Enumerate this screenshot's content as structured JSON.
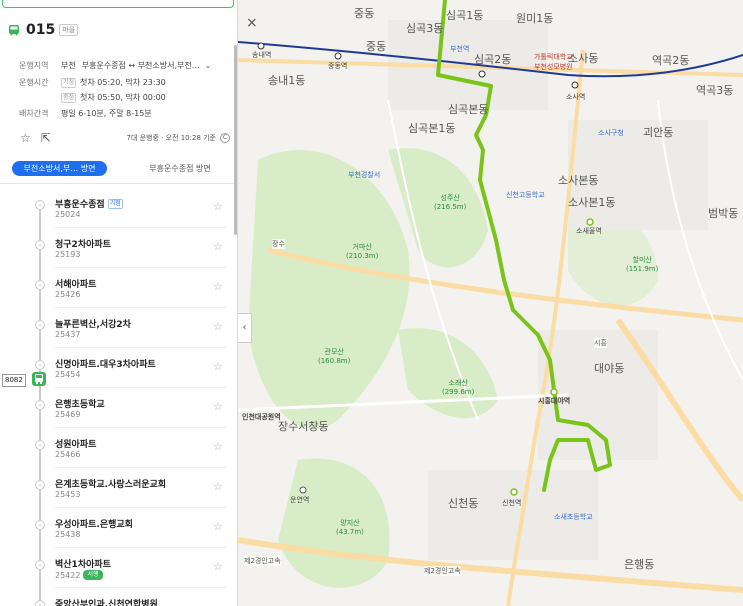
{
  "route": {
    "number": "015",
    "type": "마을"
  },
  "info": {
    "region_label": "운행지역",
    "region_city": "부천",
    "region_value": "부흥운수종점 ↔ 부천소방서,부천…",
    "time_label": "운행시간",
    "weekday_tag": "기점",
    "weekday_time": "첫차 05:20, 막차 23:30",
    "end_tag": "종점",
    "end_time": "첫차 05:50, 막차 00:00",
    "interval_label": "배차간격",
    "interval_value": "평일 6-10분, 주말 8-15분"
  },
  "actions": {
    "star_icon": "☆",
    "share_icon": "⇱",
    "status": "7대 운행중 · 오전 10:28 기준",
    "refresh_icon": "C"
  },
  "tabs": {
    "active": "부천소방서,부… 방면",
    "other": "부흥운수종점 방면"
  },
  "stops": [
    {
      "name": "부흥운수종점",
      "id": "25024",
      "tag": "기점",
      "tag_style": "blue"
    },
    {
      "name": "청구2차아파트",
      "id": "25193",
      "tag": "",
      "tag_style": ""
    },
    {
      "name": "서해아파트",
      "id": "25426",
      "tag": "",
      "tag_style": ""
    },
    {
      "name": "늘푸른벽산,서강2차",
      "id": "25437",
      "tag": "",
      "tag_style": ""
    },
    {
      "name": "신명아파트.대우3차아파트",
      "id": "25454",
      "tag": "",
      "tag_style": ""
    },
    {
      "name": "은행초등학교",
      "id": "25469",
      "tag": "",
      "tag_style": ""
    },
    {
      "name": "성원아파트",
      "id": "25466",
      "tag": "",
      "tag_style": ""
    },
    {
      "name": "은계초등학교.사랑스러운교회",
      "id": "25453",
      "tag": "",
      "tag_style": ""
    },
    {
      "name": "우성아파트.은행교회",
      "id": "25438",
      "tag": "",
      "tag_style": ""
    },
    {
      "name": "벽산1차아파트",
      "id": "25422",
      "tag": "서행",
      "tag_style": "green"
    },
    {
      "name": "중앙산부인과.신천연합병원",
      "id": "",
      "tag": "",
      "tag_style": ""
    }
  ],
  "bus": {
    "plate": "8082"
  },
  "map": {
    "controls": {
      "close": "×",
      "collapse": "‹"
    },
    "labels": {
      "jungdong": "중동",
      "simgok3": "심곡3동",
      "simgok1": "심곡1동",
      "wonmi1": "원미1동",
      "simgok2": "심곡2동",
      "songnae1": "송내1동",
      "jungdong2": "중동",
      "simgokbon1": "심곡본1동",
      "simgokbon": "심곡본동",
      "sosadong": "소사동",
      "yeokgok2": "역곡2동",
      "yeokgok3": "역곡3동",
      "goan": "괴안동",
      "sosabon": "소사본동",
      "sosabon1": "소사본1동",
      "beoman": "범박동",
      "daeya": "대야동",
      "jangsuseochang": "장수서창동",
      "sincheon": "신천동",
      "eunhaeng": "은행동",
      "songnae_station": "송내역",
      "jungdong_station": "중동역",
      "bucheon_station": "부천역",
      "sosa_station": "소사역",
      "sosaeul_station": "소새울역",
      "siheung_daeya_station": "시흥대야역",
      "sincheon_station": "신천역",
      "incheon_park_station": "인천대공원역",
      "unyeon_station": "운연역",
      "gamasan": "거마산",
      "gamasan_h": "(210.3m)",
      "seongjusan": "성주산",
      "seongjusan_h": "(216.5m)",
      "gwangeumsan": "관모산",
      "gwangeumsan_h": "(160.8m)",
      "soraesan": "소래산",
      "soraesan_h": "(299.6m)",
      "halmisan": "할미산",
      "halmisan_h": "(151.9m)",
      "yangjisan": "양지산",
      "yangjisan_h": "(43.7m)",
      "gatoreuk": "가톨릭대학교",
      "gatoreuk2": "부천성모병원",
      "road_2gyeongin": "제2경인고속",
      "road_2gyeongin2": "제2경인고속",
      "ic_jangsu": "장수",
      "ic_siheung": "시흥",
      "sosanggiri": "소사구청",
      "bucheon_police": "부천경찰서",
      "sincheon_elem": "신천고등학교",
      "sosae_elem": "소새초등학교"
    },
    "colors": {
      "route": "#7ac41a",
      "subway": "#1f3a93",
      "road": "#fbdca4",
      "park": "#d9ecc8"
    }
  }
}
